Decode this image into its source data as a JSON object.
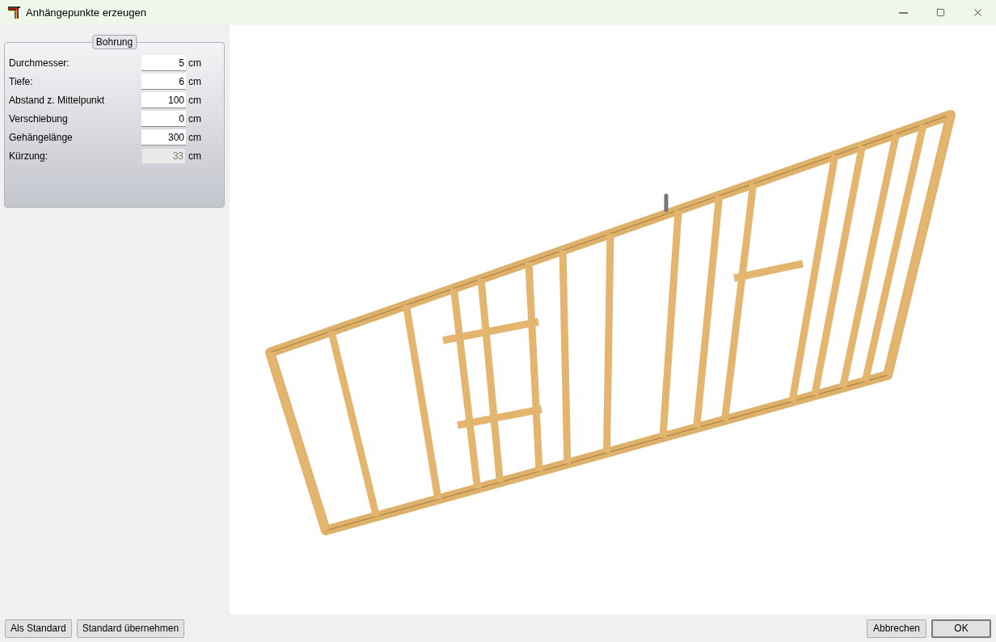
{
  "window": {
    "title": "Anhängepunkte erzeugen"
  },
  "group": {
    "title": "Bohrung",
    "fields": [
      {
        "label": "Durchmesser:",
        "value": "5",
        "unit": "cm",
        "disabled": false
      },
      {
        "label": "Tiefe:",
        "value": "6",
        "unit": "cm",
        "disabled": false
      },
      {
        "label": "Abstand z. Mittelpunkt",
        "value": "100",
        "unit": "cm",
        "disabled": false
      },
      {
        "label": "Verschiebung",
        "value": "0",
        "unit": "cm",
        "disabled": false
      },
      {
        "label": "Gehängelänge",
        "value": "300",
        "unit": "cm",
        "disabled": false
      },
      {
        "label": "Kürzung:",
        "value": "33",
        "unit": "cm",
        "disabled": true
      }
    ]
  },
  "buttons_left": [
    "Als Standard",
    "Standard übernehmen"
  ],
  "buttons_right": [
    {
      "label": "Abbrechen",
      "default": false
    },
    {
      "label": "OK",
      "default": true
    }
  ]
}
